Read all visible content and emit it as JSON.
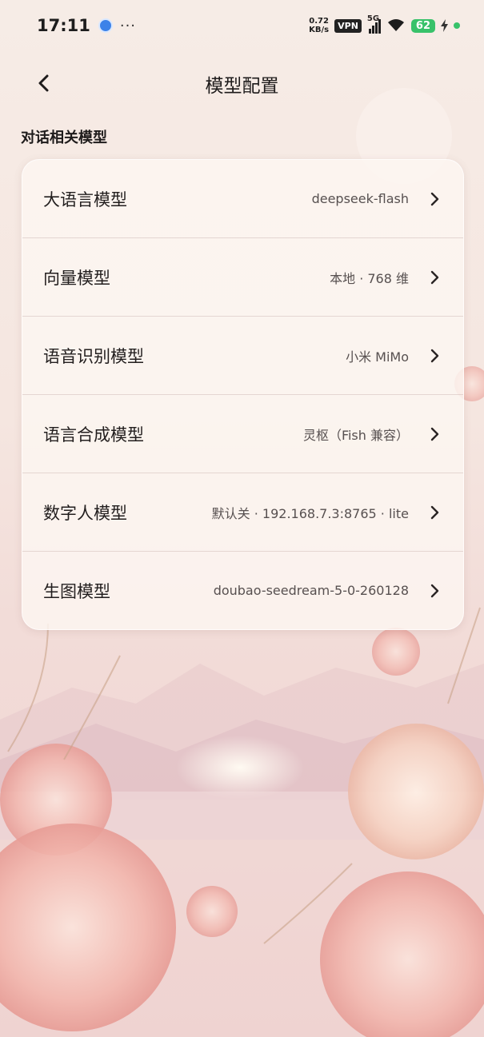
{
  "status_bar": {
    "time": "17:11",
    "more": "···",
    "speed_value": "0.72",
    "speed_unit": "KB/s",
    "vpn": "VPN",
    "network": "5G",
    "battery": "62"
  },
  "header": {
    "title": "模型配置"
  },
  "section": {
    "label": "对话相关模型"
  },
  "models": [
    {
      "label": "大语言模型",
      "value": "deepseek-flash"
    },
    {
      "label": "向量模型",
      "value": "本地 · 768 维"
    },
    {
      "label": "语音识别模型",
      "value": "小米 MiMo"
    },
    {
      "label": "语言合成模型",
      "value": "灵枢（Fish 兼容）"
    },
    {
      "label": "数字人模型",
      "value": "默认关 · 192.168.7.3:8765 · lite"
    },
    {
      "label": "生图模型",
      "value": "doubao-seedream-5-0-260128"
    }
  ],
  "colors": {
    "accent_green": "#38c26a",
    "card_bg": "#fdf6f2",
    "background_pink": "#f2dcd8"
  }
}
